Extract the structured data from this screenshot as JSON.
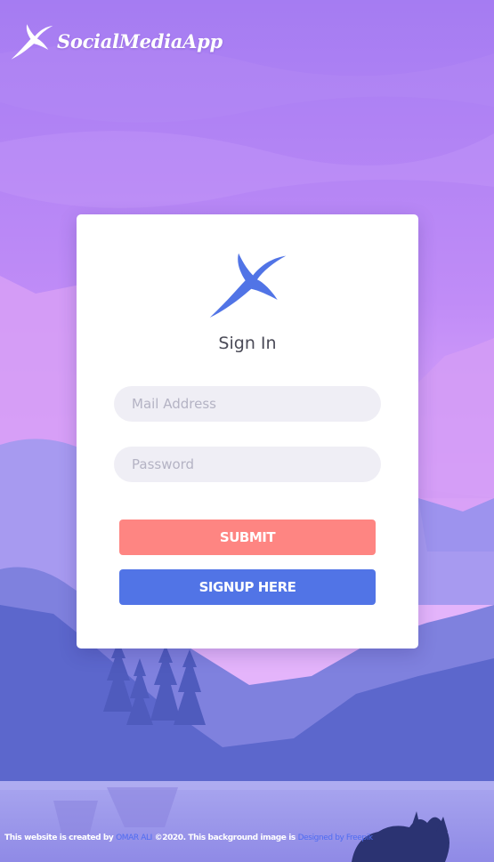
{
  "brand": {
    "name": "SocialMediaApp",
    "logo_icon": "swallow-bird-icon"
  },
  "login": {
    "logo_icon": "swallow-bird-icon",
    "title": "Sign In",
    "email_placeholder": "Mail Address",
    "email_value": "",
    "password_placeholder": "Password",
    "password_value": "",
    "submit_label": "SUBMIT",
    "signup_label": "SIGNUP HERE"
  },
  "footer": {
    "text_before_author": "This website is created by",
    "author": "OMAR ALI",
    "text_after_author": "©2020. This background image is",
    "credit_link": "Designed by Freepik"
  },
  "colors": {
    "submit": "#fe8582",
    "signup": "#5174e6",
    "logo_blue": "#5174e6",
    "link": "#4f6cf2"
  }
}
